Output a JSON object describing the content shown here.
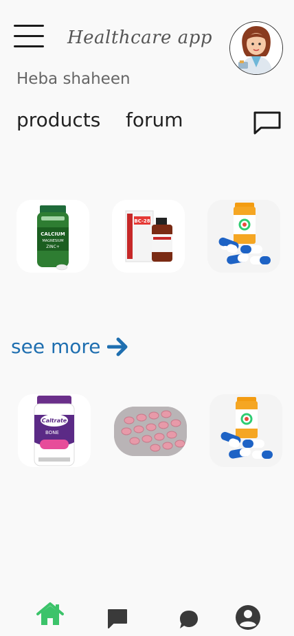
{
  "header": {
    "app_title": "Healthcare app",
    "user_name": "Heba shaheen"
  },
  "nav": {
    "products_label": "products",
    "forum_label": "forum"
  },
  "see_more": {
    "label": "see more"
  },
  "product_images": [
    {
      "name": "calcium-magnesium-zinc-bottle",
      "label_text": "CALCIUM MAGNESIUM ZINC+"
    },
    {
      "name": "bc-28-bottle",
      "label_text": "BC-28"
    },
    {
      "name": "pill-bottle-capsules"
    },
    {
      "name": "caltrate-bottle",
      "label_text": "Caltrate"
    },
    {
      "name": "pink-tablets-blister"
    },
    {
      "name": "pill-bottle-capsules"
    }
  ],
  "bottom_nav": {
    "active": "home",
    "items": [
      "home-icon",
      "message-icon",
      "chat-bubble-icon",
      "account-icon"
    ]
  },
  "colors": {
    "background": "#f9f9f9",
    "accent_link": "#1f6fb0",
    "active_nav": "#3cc36a",
    "inactive_nav": "#3a3a3a"
  }
}
